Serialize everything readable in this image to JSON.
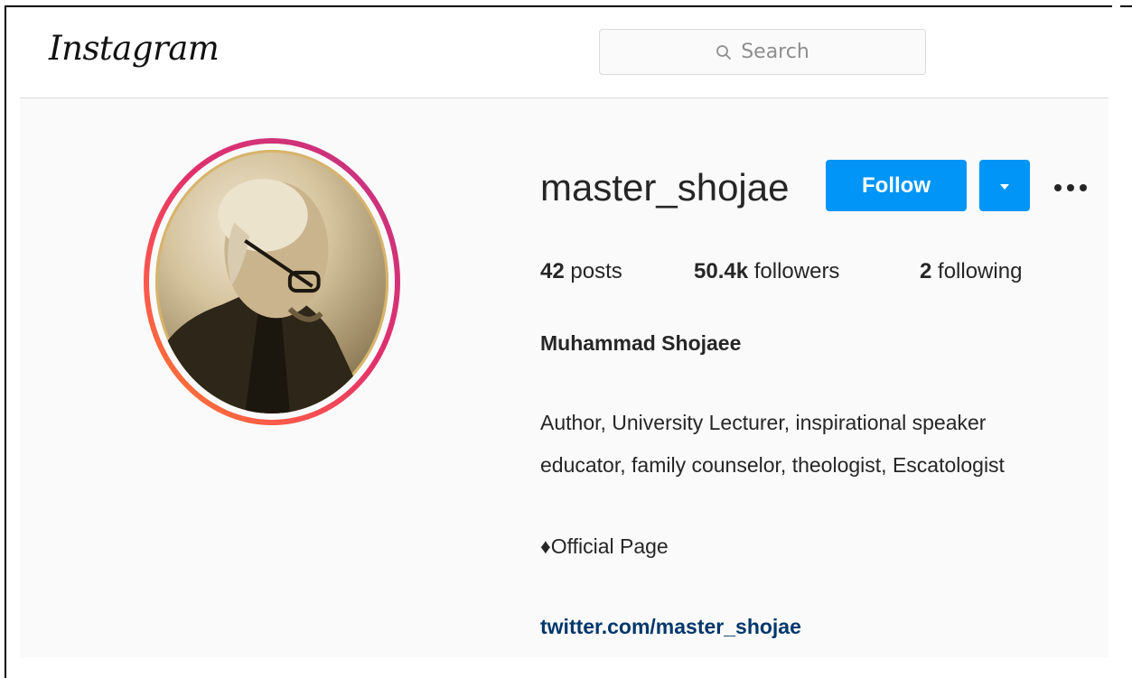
{
  "header": {
    "logo": "Instagram",
    "search": {
      "placeholder": "Search"
    }
  },
  "profile": {
    "username": "master_shojae",
    "follow_label": "Follow",
    "stats": {
      "posts_count": "42",
      "posts_label": "posts",
      "followers_count": "50.4k",
      "followers_label": "followers",
      "following_count": "2",
      "following_label": "following"
    },
    "full_name": "Muhammad Shojaee",
    "bio_line_1": "Author, University Lecturer, inspirational speaker",
    "bio_line_2": "educator, family counselor, theologist, Escatologist",
    "bio_line_3": "♦Official Page",
    "website": "twitter.com/master_shojae"
  },
  "colors": {
    "accent": "#0095f6",
    "link": "#00376b",
    "background": "#fafafa"
  },
  "icons": [
    "search-icon",
    "caret-down-icon",
    "more-options-icon"
  ]
}
